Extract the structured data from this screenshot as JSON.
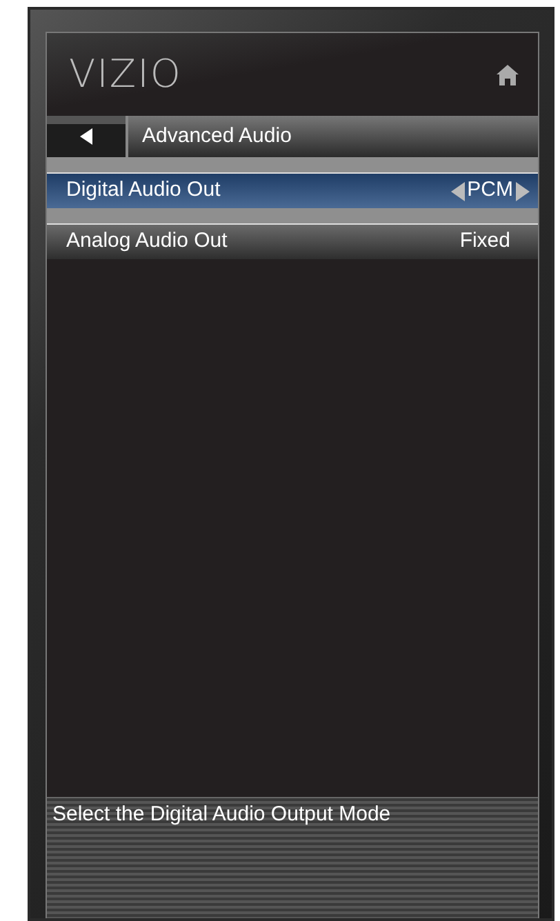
{
  "logo": "VIZIO",
  "header": {
    "title": "Advanced Audio"
  },
  "menu_items": [
    {
      "label": "Digital Audio Out",
      "value": "PCM",
      "kind": "selector",
      "selected": true
    },
    {
      "label": "Analog Audio Out",
      "value": "Fixed",
      "kind": "plain",
      "selected": false
    }
  ],
  "help_text": "Select the Digital Audio Output Mode"
}
